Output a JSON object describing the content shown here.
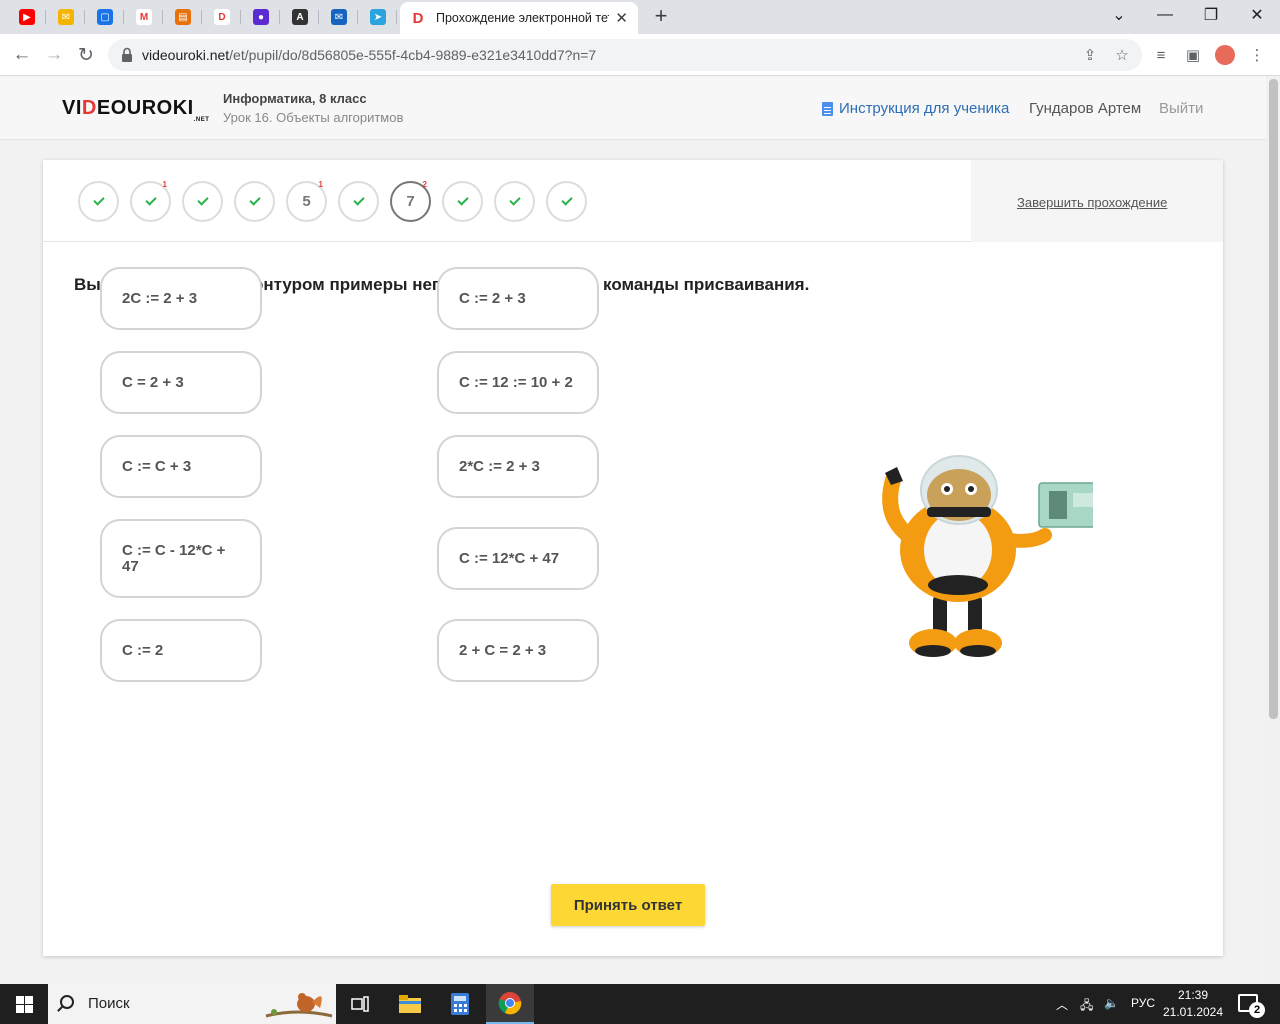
{
  "browser": {
    "pinned_tabs": [
      {
        "icon": "youtube-icon",
        "color": "#ff0000",
        "glyph": "▶"
      },
      {
        "icon": "mail-icon",
        "color": "#f4b400",
        "glyph": "✉"
      },
      {
        "icon": "chat-icon",
        "color": "#1a73e8",
        "glyph": "▢"
      },
      {
        "icon": "gmail-icon",
        "color": "#ffffff",
        "glyph": "M"
      },
      {
        "icon": "slides-icon",
        "color": "#e8710a",
        "glyph": "▤"
      },
      {
        "icon": "videouroki-icon",
        "color": "#ffffff",
        "glyph": "D"
      },
      {
        "icon": "planet-icon",
        "color": "#5b2bd1",
        "glyph": "●"
      },
      {
        "icon": "ab-icon",
        "color": "#333333",
        "glyph": "A"
      },
      {
        "icon": "outlook-icon",
        "color": "#1565c0",
        "glyph": "✉"
      },
      {
        "icon": "telegram-icon",
        "color": "#2aa3df",
        "glyph": "➤"
      }
    ],
    "active_tab_title": "Прохождение электронной тет",
    "url_host": "videouroki.net",
    "url_path": "/et/pupil/do/8d56805e-555f-4cb4-9889-e321e3410dd7?n=7"
  },
  "header": {
    "logo_main_before": "VI",
    "logo_d": "D",
    "logo_main_after": "EOUROKI",
    "logo_suffix": ".NET",
    "course": "Информатика, 8 класс",
    "lesson": "Урок 16. Объекты алгоритмов",
    "instruction_link": "Инструкция для ученика",
    "user_name": "Гундаров Артем",
    "logout": "Выйти"
  },
  "progress": {
    "questions": [
      {
        "state": "done",
        "label": "",
        "attempts": ""
      },
      {
        "state": "done",
        "label": "",
        "attempts": "1"
      },
      {
        "state": "done",
        "label": "",
        "attempts": ""
      },
      {
        "state": "done",
        "label": "",
        "attempts": ""
      },
      {
        "state": "open",
        "label": "5",
        "attempts": "1"
      },
      {
        "state": "done",
        "label": "",
        "attempts": ""
      },
      {
        "state": "current",
        "label": "7",
        "attempts": "2"
      },
      {
        "state": "done",
        "label": "",
        "attempts": ""
      },
      {
        "state": "done",
        "label": "",
        "attempts": ""
      },
      {
        "state": "done",
        "label": "",
        "attempts": ""
      }
    ],
    "finish_link": "Завершить прохождение"
  },
  "question": {
    "text": "Выделите красным контуром примеры неправильной записи команды присваивания.",
    "options_left": [
      "2C := 2 + 3",
      "C = 2 + 3",
      "C := C + 3",
      "C := C - 12*C + 47",
      "C := 2"
    ],
    "options_right": [
      "C := 2 + 3",
      "C := 12 := 10 + 2",
      "2*C := 2 + 3",
      "C := 12*C + 47",
      "2 + C = 2 + 3"
    ],
    "submit": "Принять ответ"
  },
  "taskbar": {
    "search_placeholder": "Поиск",
    "lang": "РУС",
    "time": "21:39",
    "date": "21.01.2024",
    "notifications": "2"
  },
  "colors": {
    "accent_yellow": "#fdd835",
    "check_green": "#2bb24c",
    "attempt_red": "#e53935",
    "link_blue": "#2c6db5"
  }
}
